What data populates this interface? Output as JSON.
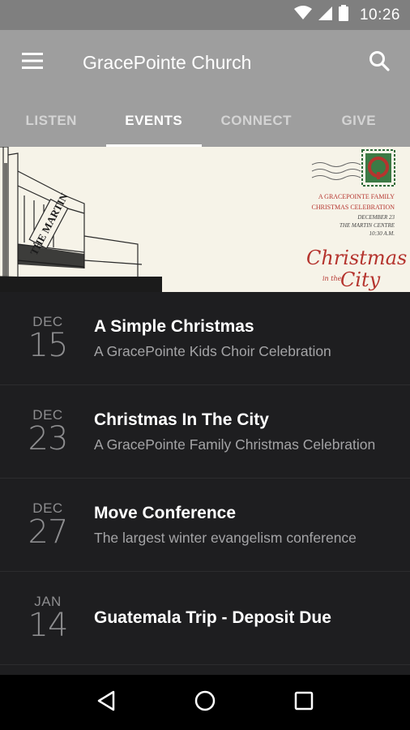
{
  "status_bar": {
    "time": "10:26"
  },
  "app_bar": {
    "title": "GracePointe Church"
  },
  "tabs": [
    {
      "label": "LISTEN",
      "active": false
    },
    {
      "label": "EVENTS",
      "active": true
    },
    {
      "label": "CONNECT",
      "active": false
    },
    {
      "label": "GIVE",
      "active": false
    }
  ],
  "banner": {
    "building_sign": "THE MARTIN",
    "invite_line1": "A GRACEPOINTE FAMILY",
    "invite_line2": "CHRISTMAS CELEBRATION",
    "date_line": "DECEMBER 23",
    "venue_line": "THE MARTIN CENTRE",
    "time_line": "10:30 A.M.",
    "script_line1": "Christmas",
    "script_line2": "in the",
    "script_line3": "City"
  },
  "events": [
    {
      "month": "DEC",
      "day": "15",
      "title": "A Simple Christmas",
      "subtitle": "A GracePointe Kids Choir Celebration"
    },
    {
      "month": "DEC",
      "day": "23",
      "title": "Christmas In The City",
      "subtitle": "A GracePointe Family Christmas Celebration"
    },
    {
      "month": "DEC",
      "day": "27",
      "title": "Move Conference",
      "subtitle": "The largest winter evangelism conference"
    },
    {
      "month": "JAN",
      "day": "14",
      "title": "Guatemala Trip - Deposit Due",
      "subtitle": ""
    }
  ],
  "icons": {
    "menu": "menu-icon",
    "search": "search-icon",
    "wifi": "wifi-icon",
    "signal": "signal-icon",
    "battery": "battery-icon",
    "back": "back-icon",
    "home": "home-icon",
    "recents": "recents-icon"
  },
  "colors": {
    "app_bar": "#9e9e9e",
    "status_bar": "#7f7f7f",
    "list_bg": "#1e1e20",
    "accent_red": "#b5342e"
  }
}
